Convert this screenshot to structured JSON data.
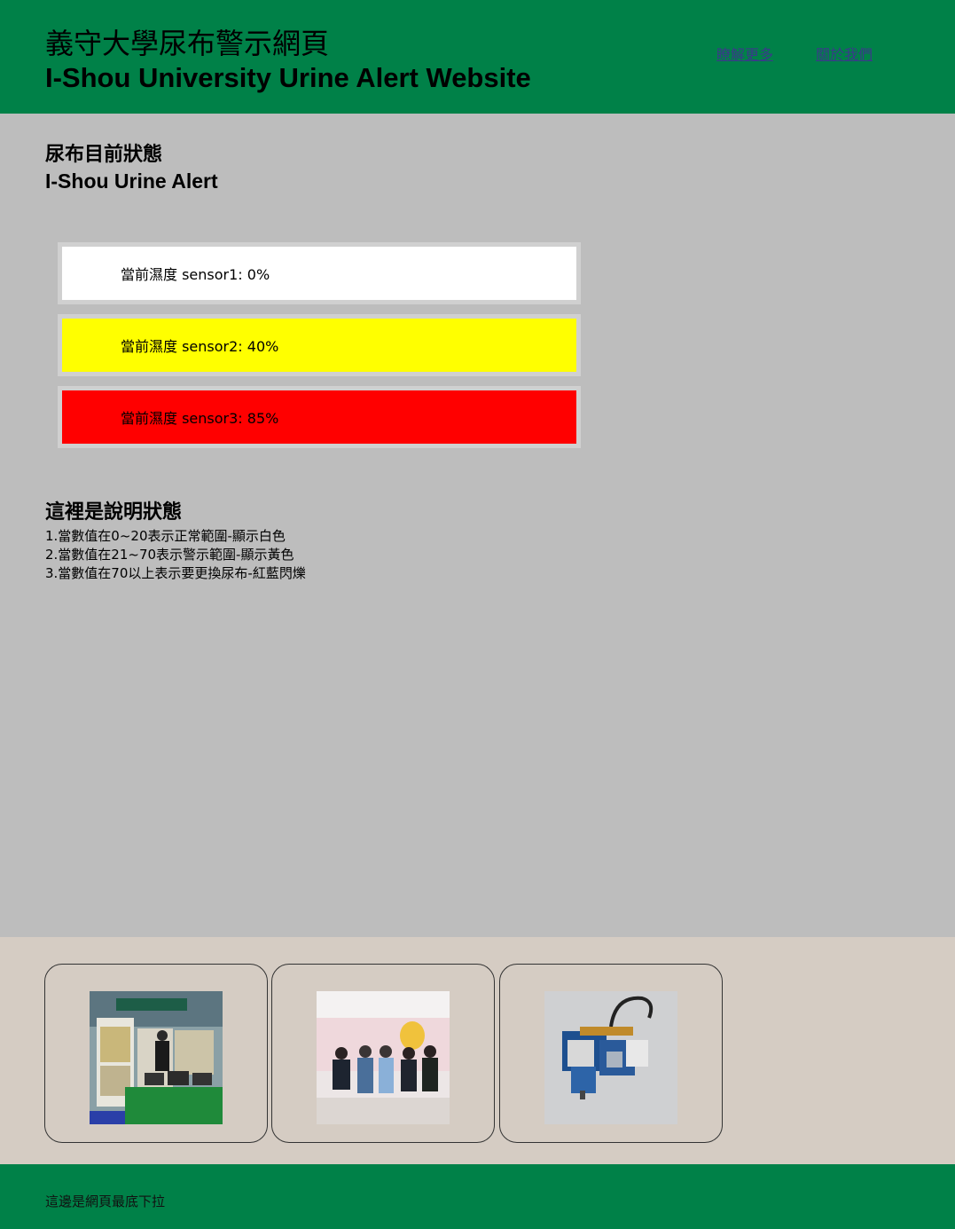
{
  "header": {
    "title_zh": "義守大學尿布警示網頁",
    "title_en": "I-Shou University Urine Alert Website",
    "nav": [
      {
        "label": "瞭解更多"
      },
      {
        "label": "關於我們"
      }
    ]
  },
  "status": {
    "title_zh": "尿布目前狀態",
    "title_en": "I-Shou Urine Alert",
    "sensors": [
      {
        "label": "當前濕度 sensor1: 0%",
        "color": "#ffffff",
        "value": 0
      },
      {
        "label": "當前濕度 sensor2: 40%",
        "color": "#ffff00",
        "value": 40
      },
      {
        "label": "當前濕度 sensor3: 85%",
        "color": "#ff0000",
        "value": 85
      }
    ]
  },
  "explanation": {
    "title": "這裡是說明狀態",
    "lines": [
      "1.當數值在0~20表示正常範圍-顯示白色",
      "2.當數值在21~70表示警示範圍-顯示黃色",
      "3.當數值在70以上表示要更換尿布-紅藍閃爍"
    ]
  },
  "gallery": {
    "images": [
      {
        "icon": "exhibition-booth-photo"
      },
      {
        "icon": "group-photo"
      },
      {
        "icon": "circuit-board-photo"
      }
    ]
  },
  "footer": {
    "text": "這邊是網頁最底下拉"
  },
  "colors": {
    "brand_green": "#008148",
    "page_gray": "#bdbdbd",
    "gallery_bg": "#d5ccc3"
  }
}
